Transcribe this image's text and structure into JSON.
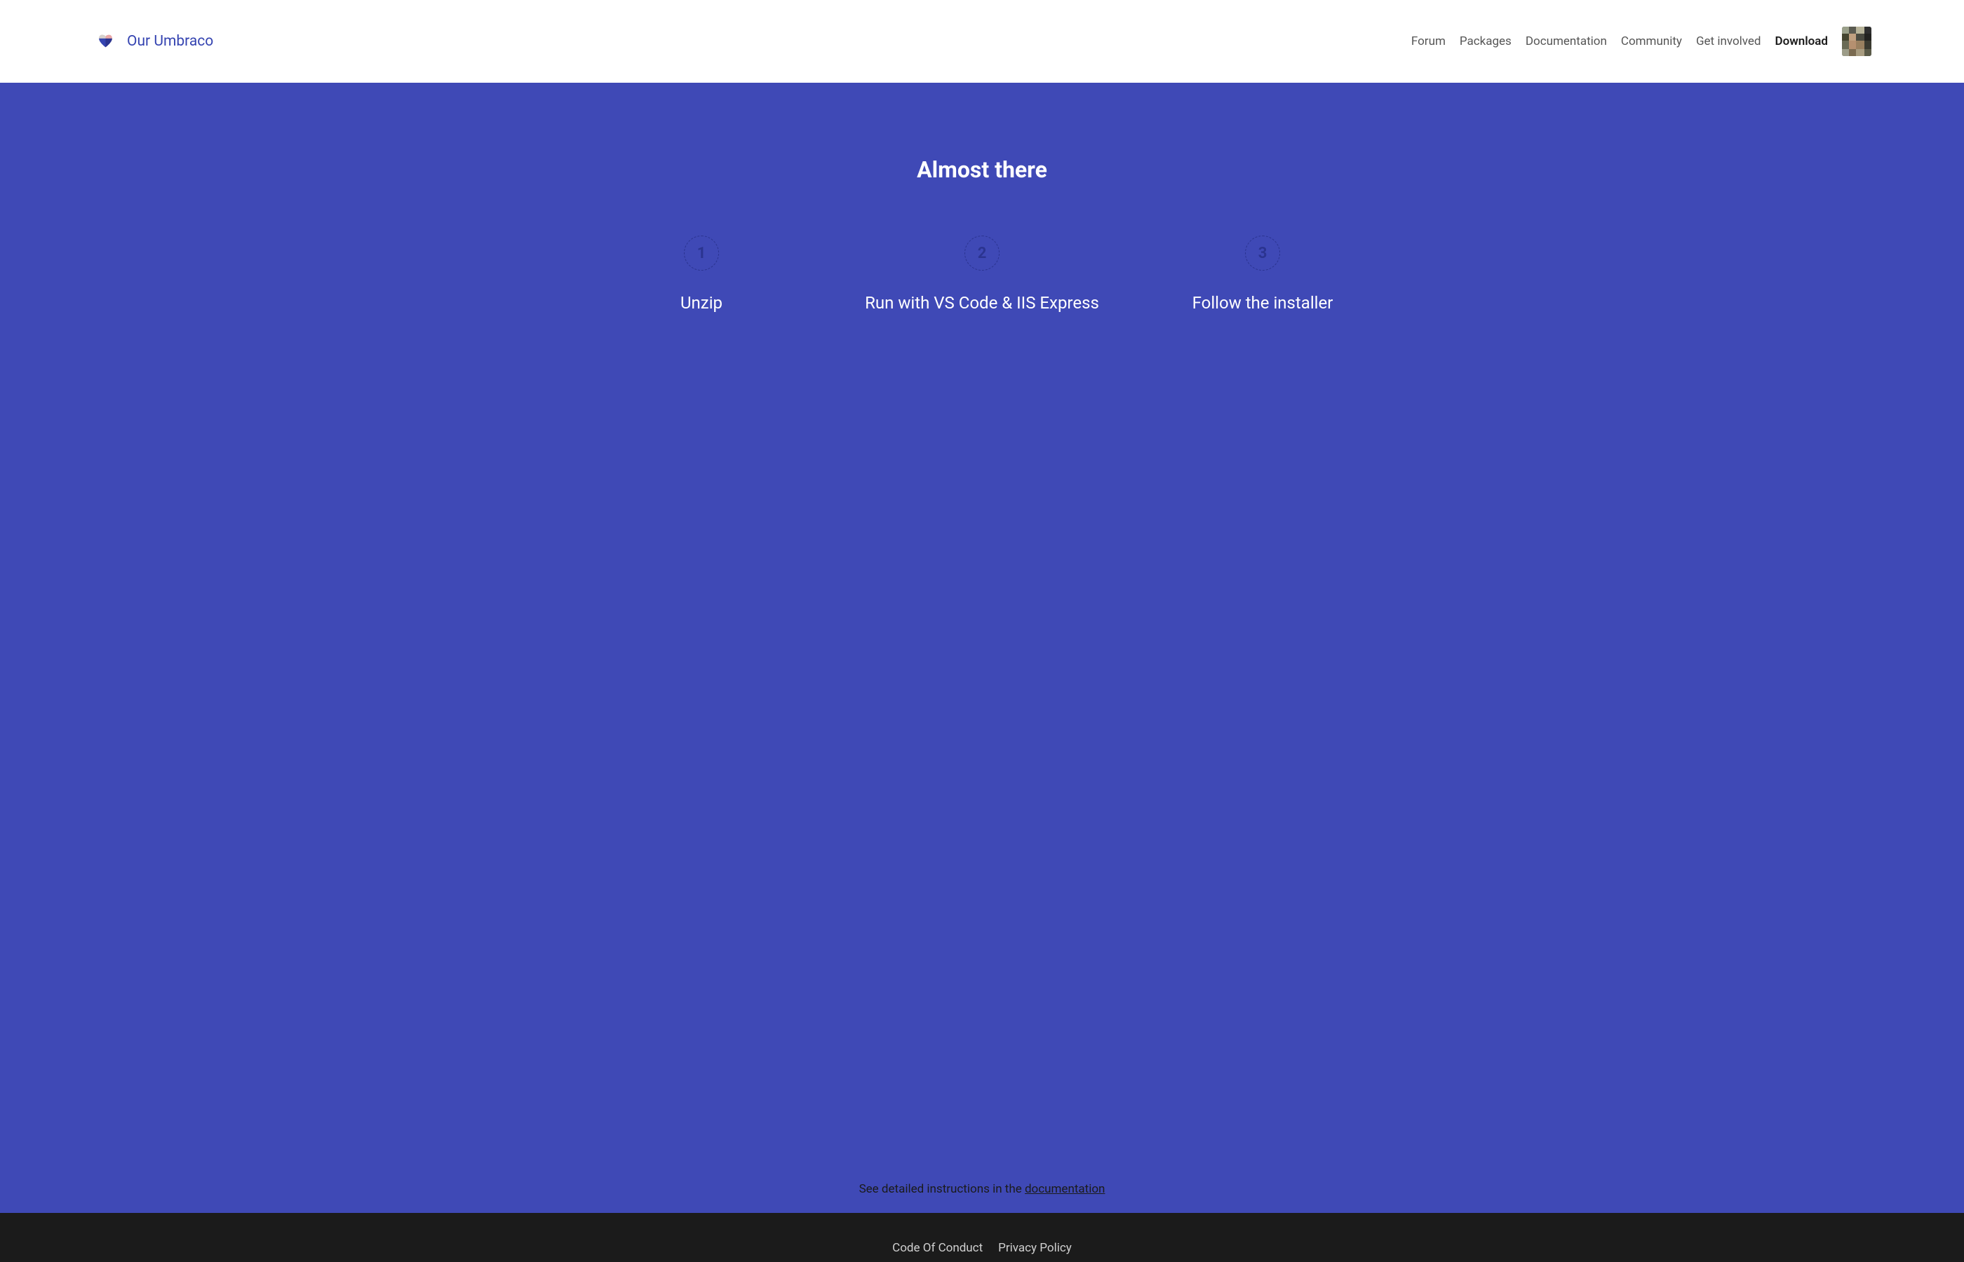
{
  "header": {
    "site_title": "Our Umbraco",
    "nav": [
      {
        "label": "Forum",
        "active": false
      },
      {
        "label": "Packages",
        "active": false
      },
      {
        "label": "Documentation",
        "active": false
      },
      {
        "label": "Community",
        "active": false
      },
      {
        "label": "Get involved",
        "active": false
      },
      {
        "label": "Download",
        "active": true
      }
    ]
  },
  "hero": {
    "title": "Almost there",
    "steps": [
      {
        "number": "1",
        "label": "Unzip"
      },
      {
        "number": "2",
        "label": "Run with VS Code & IIS Express"
      },
      {
        "number": "3",
        "label": "Follow the installer"
      }
    ],
    "doc_note_prefix": "See detailed instructions in the ",
    "doc_link_text": "documentation"
  },
  "footer": {
    "links": [
      {
        "label": "Code Of Conduct"
      },
      {
        "label": "Privacy Policy"
      }
    ]
  },
  "icons": {
    "logo": "umbraco-heart-logo"
  },
  "colors": {
    "brand_blue": "#3544b1",
    "hero_bg": "#3f49b6",
    "step_circle": "#2b3490",
    "footer_bg": "#1b1b1b"
  }
}
